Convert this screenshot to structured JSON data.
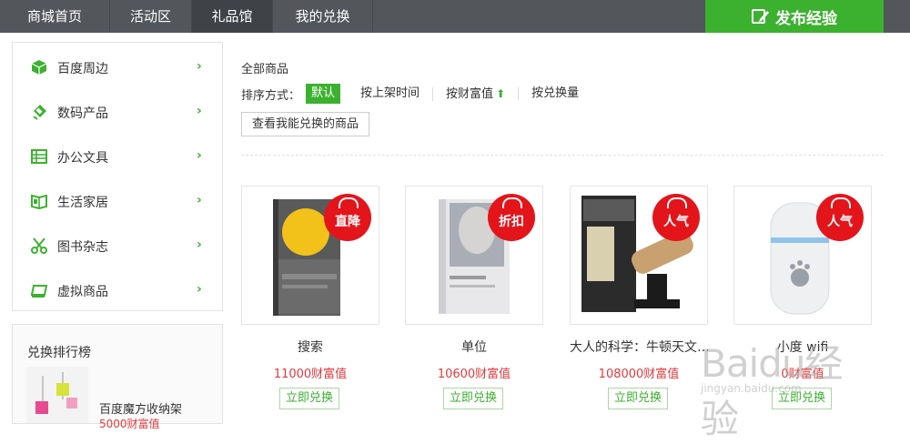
{
  "nav": {
    "items": [
      {
        "label": "商城首页",
        "active": false
      },
      {
        "label": "活动区",
        "active": false
      },
      {
        "label": "礼品馆",
        "active": true
      },
      {
        "label": "我的兑换",
        "active": false
      }
    ],
    "publish_label": "发布经验",
    "publish_icon": "edit-icon"
  },
  "sidebar": {
    "categories": [
      {
        "label": "百度周边",
        "icon": "cube-icon"
      },
      {
        "label": "数码产品",
        "icon": "digital-icon"
      },
      {
        "label": "办公文具",
        "icon": "table-icon"
      },
      {
        "label": "生活家居",
        "icon": "book-open-icon"
      },
      {
        "label": "图书杂志",
        "icon": "scissors-icon"
      },
      {
        "label": "虚拟商品",
        "icon": "card-icon"
      }
    ],
    "arrow": "›"
  },
  "ranking": {
    "title": "兑换排行榜",
    "item_name": "百度魔方收纳架",
    "item_value": "5000财富值"
  },
  "main": {
    "all_label": "全部商品",
    "sort_prefix": "排序方式：",
    "sort_options": [
      "默认",
      "按上架时间",
      "按财富值",
      "按兑换量"
    ],
    "sort_arrow": "⬆",
    "check_button": "查看我能兑换的商品"
  },
  "products": [
    {
      "name": "搜索",
      "price": "11000财富值",
      "tag": "直降",
      "button": "立即兑换"
    },
    {
      "name": "单位",
      "price": "10600财富值",
      "tag": "折扣",
      "button": "立即兑换"
    },
    {
      "name": "大人的科学：牛顿天文…",
      "price": "108000财富值",
      "tag": "人气",
      "button": "立即兑换"
    },
    {
      "name": "小度 wifi",
      "price": "0财富值",
      "tag": "人气",
      "button": "立即兑换"
    }
  ],
  "watermark": {
    "text": "Baidu经验",
    "sub": "jingyan.baidu.com"
  },
  "colors": {
    "green": "#3cb12f",
    "red": "#e4141b",
    "topbar": "#53565b",
    "price": "#e4393c"
  }
}
